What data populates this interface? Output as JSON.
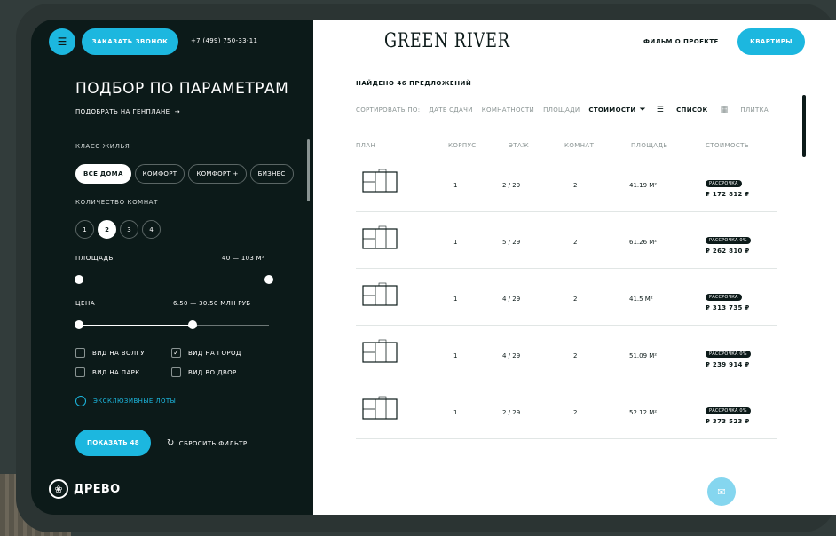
{
  "header": {
    "callback_label": "ЗАКАЗАТЬ ЗВОНОК",
    "phone": "+7 (499) 750-33-11",
    "logo": "GREEN RIVER",
    "film_link": "ФИЛЬМ О ПРОЕКТЕ",
    "apartments_label": "КВАРТИРЫ"
  },
  "filter": {
    "title": "ПОДБОР ПО ПАРАМЕТРАМ",
    "plan_link": "ПОДОБРАТЬ НА ГЕНПЛАНЕ",
    "class_label": "КЛАСС ЖИЛЬЯ",
    "classes": [
      {
        "label": "ВСЕ ДОМА",
        "active": true
      },
      {
        "label": "КОМФОРТ",
        "active": false
      },
      {
        "label": "КОМФОРТ +",
        "active": false
      },
      {
        "label": "БИЗНЕС",
        "active": false
      }
    ],
    "rooms_label": "КОЛИЧЕСТВО КОМНАТ",
    "rooms": [
      "1",
      "2",
      "3",
      "4"
    ],
    "rooms_active": "2",
    "area_label": "ПЛОЩАДЬ",
    "area_value": "40 — 103 М²",
    "area_range": [
      0,
      1
    ],
    "price_label": "ЦЕНА",
    "price_value": "6.50 — 30.50 МЛН РУБ",
    "price_range": [
      0,
      0.6
    ],
    "views": [
      {
        "label": "ВИД НА ВОЛГУ",
        "checked": false
      },
      {
        "label": "ВИД НА ГОРОД",
        "checked": true
      },
      {
        "label": "ВИД НА ПАРК",
        "checked": false
      },
      {
        "label": "ВИД ВО ДВОР",
        "checked": false
      }
    ],
    "exclusive_label": "ЭКСКЛЮЗИВНЫЕ ЛОТЫ",
    "show_label": "ПОКАЗАТЬ 48",
    "reset_label": "СБРОСИТЬ ФИЛЬТР"
  },
  "brand": {
    "name": "ДРЕВО"
  },
  "results": {
    "found": "НАЙДЕНО 46 ПРЕДЛОЖЕНИЙ",
    "sort_label": "СОРТИРОВАТЬ ПО:",
    "sort_options": [
      "ДАТЕ СДАЧИ",
      "КОМНАТНОСТИ",
      "ПЛОЩАДИ"
    ],
    "sort_active": "СТОИМОСТИ",
    "view_list": "СПИСОК",
    "view_tile": "ПЛИТКА",
    "columns": [
      "ПЛАН",
      "КОРПУС",
      "ЭТАЖ",
      "КОМНАТ",
      "ПЛОЩАДЬ",
      "СТОИМОСТЬ"
    ],
    "rows": [
      {
        "building": "1",
        "floor": "2 / 29",
        "rooms": "2",
        "area": "41.19 М²",
        "tag": "РАССРОЧКА",
        "price": "₽ 172 812 ₽"
      },
      {
        "building": "1",
        "floor": "5 / 29",
        "rooms": "2",
        "area": "61.26 М²",
        "tag": "РАССРОЧКА 0%",
        "price": "₽ 262 810 ₽"
      },
      {
        "building": "1",
        "floor": "4 / 29",
        "rooms": "2",
        "area": "41.5 М²",
        "tag": "РАССРОЧКА",
        "price": "₽ 313 735 ₽"
      },
      {
        "building": "1",
        "floor": "4 / 29",
        "rooms": "2",
        "area": "51.09 М²",
        "tag": "РАССРОЧКА 0%",
        "price": "₽ 239 914 ₽"
      },
      {
        "building": "1",
        "floor": "2 / 29",
        "rooms": "2",
        "area": "52.12 М²",
        "tag": "РАССРОЧКА 0%",
        "price": "₽ 373 523 ₽"
      }
    ]
  },
  "colors": {
    "accent": "#1cb7df",
    "dark": "#0c1a19"
  }
}
